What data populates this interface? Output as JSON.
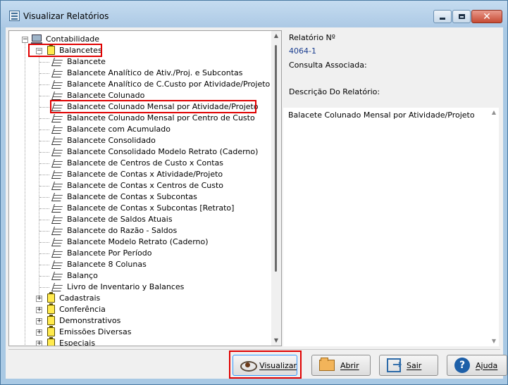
{
  "window": {
    "title": "Visualizar Relatórios"
  },
  "tree": {
    "root": "Contabilidade",
    "group_open": "Balancetes",
    "reports": [
      "Balancete",
      "Balancete Analítico de Ativ./Proj. e Subcontas",
      "Balancete Analítico de C.Custo por Atividade/Projeto",
      "Balancete Colunado",
      "Balancete Colunado Mensal por Atividade/Projeto",
      "Balancete Colunado Mensal por Centro de Custo",
      "Balancete com Acumulado",
      "Balancete Consolidado",
      "Balancete Consolidado Modelo Retrato (Caderno)",
      "Balancete de Centros de Custo x Contas",
      "Balancete de Contas x Atividade/Projeto",
      "Balancete de Contas x Centros de Custo",
      "Balancete de Contas x Subcontas",
      "Balancete de Contas x Subcontas [Retrato]",
      "Balancete de Saldos Atuais",
      "Balancete do Razão - Saldos",
      "Balancete Modelo Retrato (Caderno)",
      "Balancete Por Período",
      "Balancete 8 Colunas",
      "Balanço",
      "Livro de Inventario y Balances"
    ],
    "groups_closed": [
      "Cadastrais",
      "Conferência",
      "Demonstrativos",
      "Emissões Diversas",
      "Especiais"
    ]
  },
  "info": {
    "report_no_label": "Relatório Nº",
    "report_no_value": "4064-1",
    "query_label": "Consulta Associada:",
    "desc_label": "Descrição Do Relatório:",
    "desc_text": "Balacete Colunado Mensal por Atividade/Projeto"
  },
  "buttons": {
    "visualizar": "Visualizar",
    "abrir": "Abrir",
    "sair": "Sair",
    "ajuda": "Ajuda"
  },
  "colors": {
    "highlight": "#e00000",
    "link_value": "#1a3d8f"
  }
}
